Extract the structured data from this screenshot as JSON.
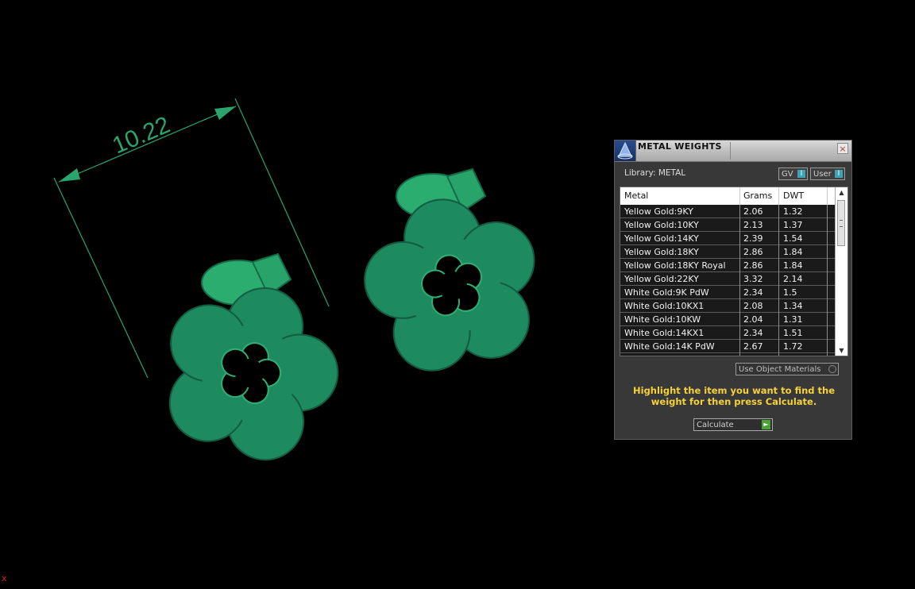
{
  "viewport": {
    "dimension_label": "10.22",
    "axis_marker": "x",
    "model_color": "#1f8f62",
    "dimension_color": "#2aa56e"
  },
  "panel": {
    "title": "METAL WEIGHTS",
    "close_label": "×",
    "library_label": "Library: METAL",
    "gv_label": "GV",
    "gv_indicator": "I",
    "user_label": "User",
    "user_indicator": "I",
    "columns": [
      "Metal",
      "Grams",
      "DWT"
    ],
    "rows": [
      {
        "metal": "Yellow Gold:9KY",
        "grams": "2.06",
        "dwt": "1.32"
      },
      {
        "metal": "Yellow Gold:10KY",
        "grams": "2.13",
        "dwt": "1.37"
      },
      {
        "metal": "Yellow Gold:14KY",
        "grams": "2.39",
        "dwt": "1.54"
      },
      {
        "metal": "Yellow Gold:18KY",
        "grams": "2.86",
        "dwt": "1.84"
      },
      {
        "metal": "Yellow Gold:18KY Royal",
        "grams": "2.86",
        "dwt": "1.84"
      },
      {
        "metal": "Yellow Gold:22KY",
        "grams": "3.32",
        "dwt": "2.14"
      },
      {
        "metal": "White Gold:9K PdW",
        "grams": "2.34",
        "dwt": "1.5"
      },
      {
        "metal": "White Gold:10KX1",
        "grams": "2.08",
        "dwt": "1.34"
      },
      {
        "metal": "White Gold:10KW",
        "grams": "2.04",
        "dwt": "1.31"
      },
      {
        "metal": "White Gold:14KX1",
        "grams": "2.34",
        "dwt": "1.51"
      },
      {
        "metal": "White Gold:14K PdW",
        "grams": "2.67",
        "dwt": "1.72"
      }
    ],
    "use_object_materials_label": "Use Object Materials",
    "instructions": "Highlight the item you want to find the weight for then press Calculate.",
    "calculate_label": "Calculate",
    "calculate_icon": "►",
    "scroll_up_icon": "▲",
    "scroll_down_icon": "▼",
    "accent_color": "#f6d23a"
  }
}
